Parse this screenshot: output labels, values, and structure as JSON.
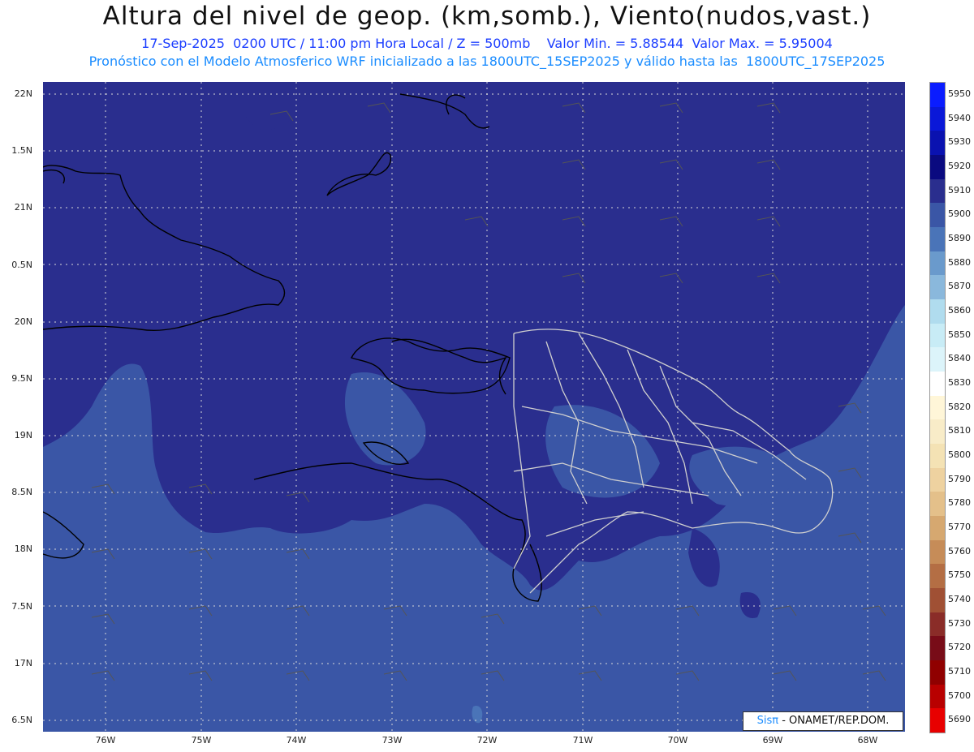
{
  "header": {
    "title": "Altura del nivel de geop. (km,somb.), Viento(nudos,vast.)",
    "line1": "17-Sep-2025  0200 UTC / 11:00 pm Hora Local / Z = 500mb    Valor Min. = 5.88544  Valor Max. = 5.95004",
    "line2": "Pronóstico con el Modelo Atmosferico WRF inicializado a las 1800UTC_15SEP2025 y válido hasta las  1800UTC_17SEP2025"
  },
  "axes": {
    "lat_labels": [
      "22N",
      "1.5N",
      "21N",
      "0.5N",
      "20N",
      "9.5N",
      "19N",
      "8.5N",
      "18N",
      "7.5N",
      "17N",
      "6.5N"
    ],
    "lon_labels": [
      "76W",
      "75W",
      "74W",
      "73W",
      "72W",
      "71W",
      "70W",
      "69W",
      "68W"
    ]
  },
  "legend": {
    "labels": [
      "5950",
      "5940",
      "5930",
      "5920",
      "5910",
      "5900",
      "5890",
      "5880",
      "5870",
      "5860",
      "5850",
      "5840",
      "5830",
      "5820",
      "5810",
      "5800",
      "5790",
      "5780",
      "5770",
      "5760",
      "5750",
      "5740",
      "5730",
      "5720",
      "5710",
      "5700",
      "5690"
    ],
    "colors": [
      "#0a1cff",
      "#0a18d8",
      "#0a12b0",
      "#0a0a80",
      "#2a2e8e",
      "#3a56a6",
      "#4a74b8",
      "#6a9acc",
      "#8ab8dc",
      "#b0dcee",
      "#c8ecf6",
      "#dcf4fa",
      "#ffffff",
      "#fff6d8",
      "#f8ecc8",
      "#f4e2b4",
      "#eed2a0",
      "#e4c08a",
      "#d6a870",
      "#c68c58",
      "#b46e44",
      "#a05034",
      "#8a2c28",
      "#780c18",
      "#900000",
      "#b80000",
      "#e80000"
    ]
  },
  "credit": {
    "logo": "Sisπ",
    "text": " - ONAMET/REP.DOM."
  },
  "colors": {
    "shade_main": "#3a56a6",
    "shade_north": "#2a2e8e",
    "coast": "#000000",
    "provinces": "#cfcfcf"
  }
}
